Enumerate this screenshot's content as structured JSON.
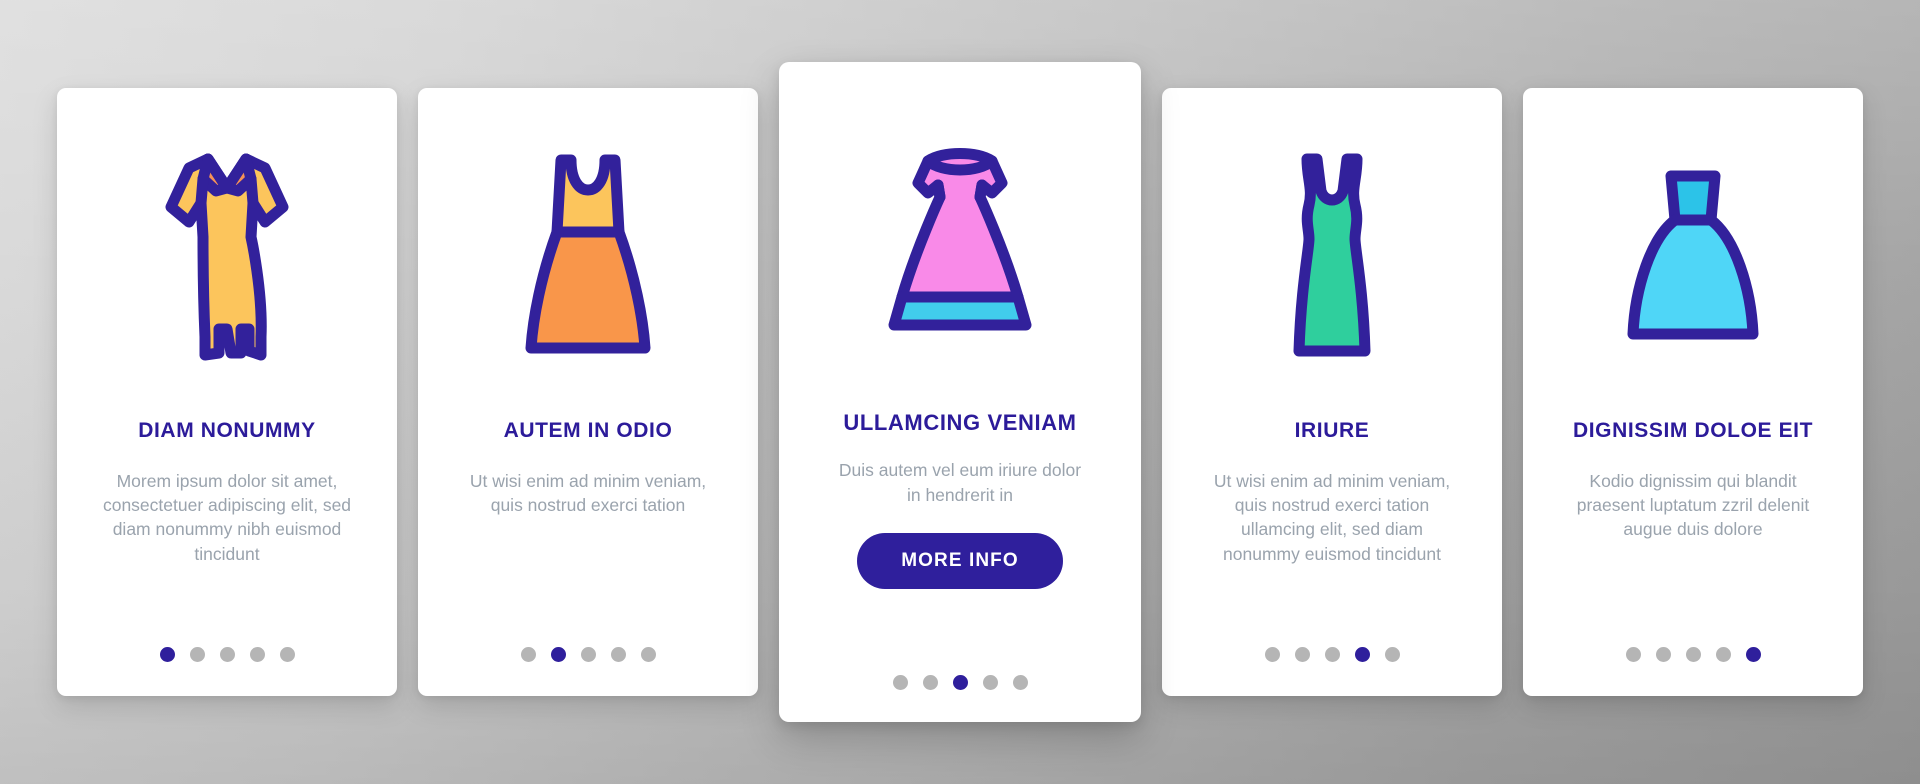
{
  "meta": {
    "background_color": "#c3c3c3",
    "card_background": "#ffffff",
    "accent_color": "#2f1f9c",
    "title_color": "#2c1b9a",
    "body_color": "#9aa3ad",
    "dot_inactive_color": "#b5b5b5"
  },
  "cards": [
    {
      "icon_name": "dress-short-sleeve-collar-icon",
      "icon_colors": {
        "outline": "#32219b",
        "fill": "#fcc55c",
        "accent": "#f79256"
      },
      "title": "DIAM NONUMMY",
      "body": "Morem ipsum dolor sit amet, consectetuer adipiscing elit, sed diam nonummy nibh euismod tincidunt",
      "dots_total": 5,
      "dot_active_index": 0,
      "featured": false
    },
    {
      "icon_name": "dress-sleeveless-flare-icon",
      "icon_colors": {
        "outline": "#32219b",
        "fill": "#fcc55c",
        "accent": "#f9964a"
      },
      "title": "AUTEM IN ODIO",
      "body": "Ut wisi enim ad minim veniam, quis nostrud exerci tation",
      "dots_total": 5,
      "dot_active_index": 1,
      "featured": false
    },
    {
      "icon_name": "dress-off-shoulder-gown-icon",
      "icon_colors": {
        "outline": "#32219b",
        "fill": "#f98ae8",
        "accent": "#41cdec"
      },
      "title": "ULLAMCING VENIAM",
      "body": "Duis autem vel eum iriure dolor in hendrerit in",
      "cta_label": "MORE INFO",
      "dots_total": 5,
      "dot_active_index": 2,
      "featured": true
    },
    {
      "icon_name": "dress-bodycon-vneck-icon",
      "icon_colors": {
        "outline": "#32219b",
        "fill": "#2fcf9d",
        "accent": "#2fcf9d"
      },
      "title": "IRIURE",
      "body": "Ut wisi enim ad minim veniam, quis nostrud exerci tation ullamcing elit, sed diam nonummy euismod tincidunt",
      "dots_total": 5,
      "dot_active_index": 3,
      "featured": false
    },
    {
      "icon_name": "dress-ballgown-bodice-icon",
      "icon_colors": {
        "outline": "#32219b",
        "fill": "#4fd6f7",
        "accent": "#2cc3e8"
      },
      "title": "DIGNISSIM DOLOE EIT",
      "body": "Kodio dignissim qui blandit praesent luptatum zzril delenit augue duis dolore",
      "dots_total": 5,
      "dot_active_index": 4,
      "featured": false
    }
  ]
}
